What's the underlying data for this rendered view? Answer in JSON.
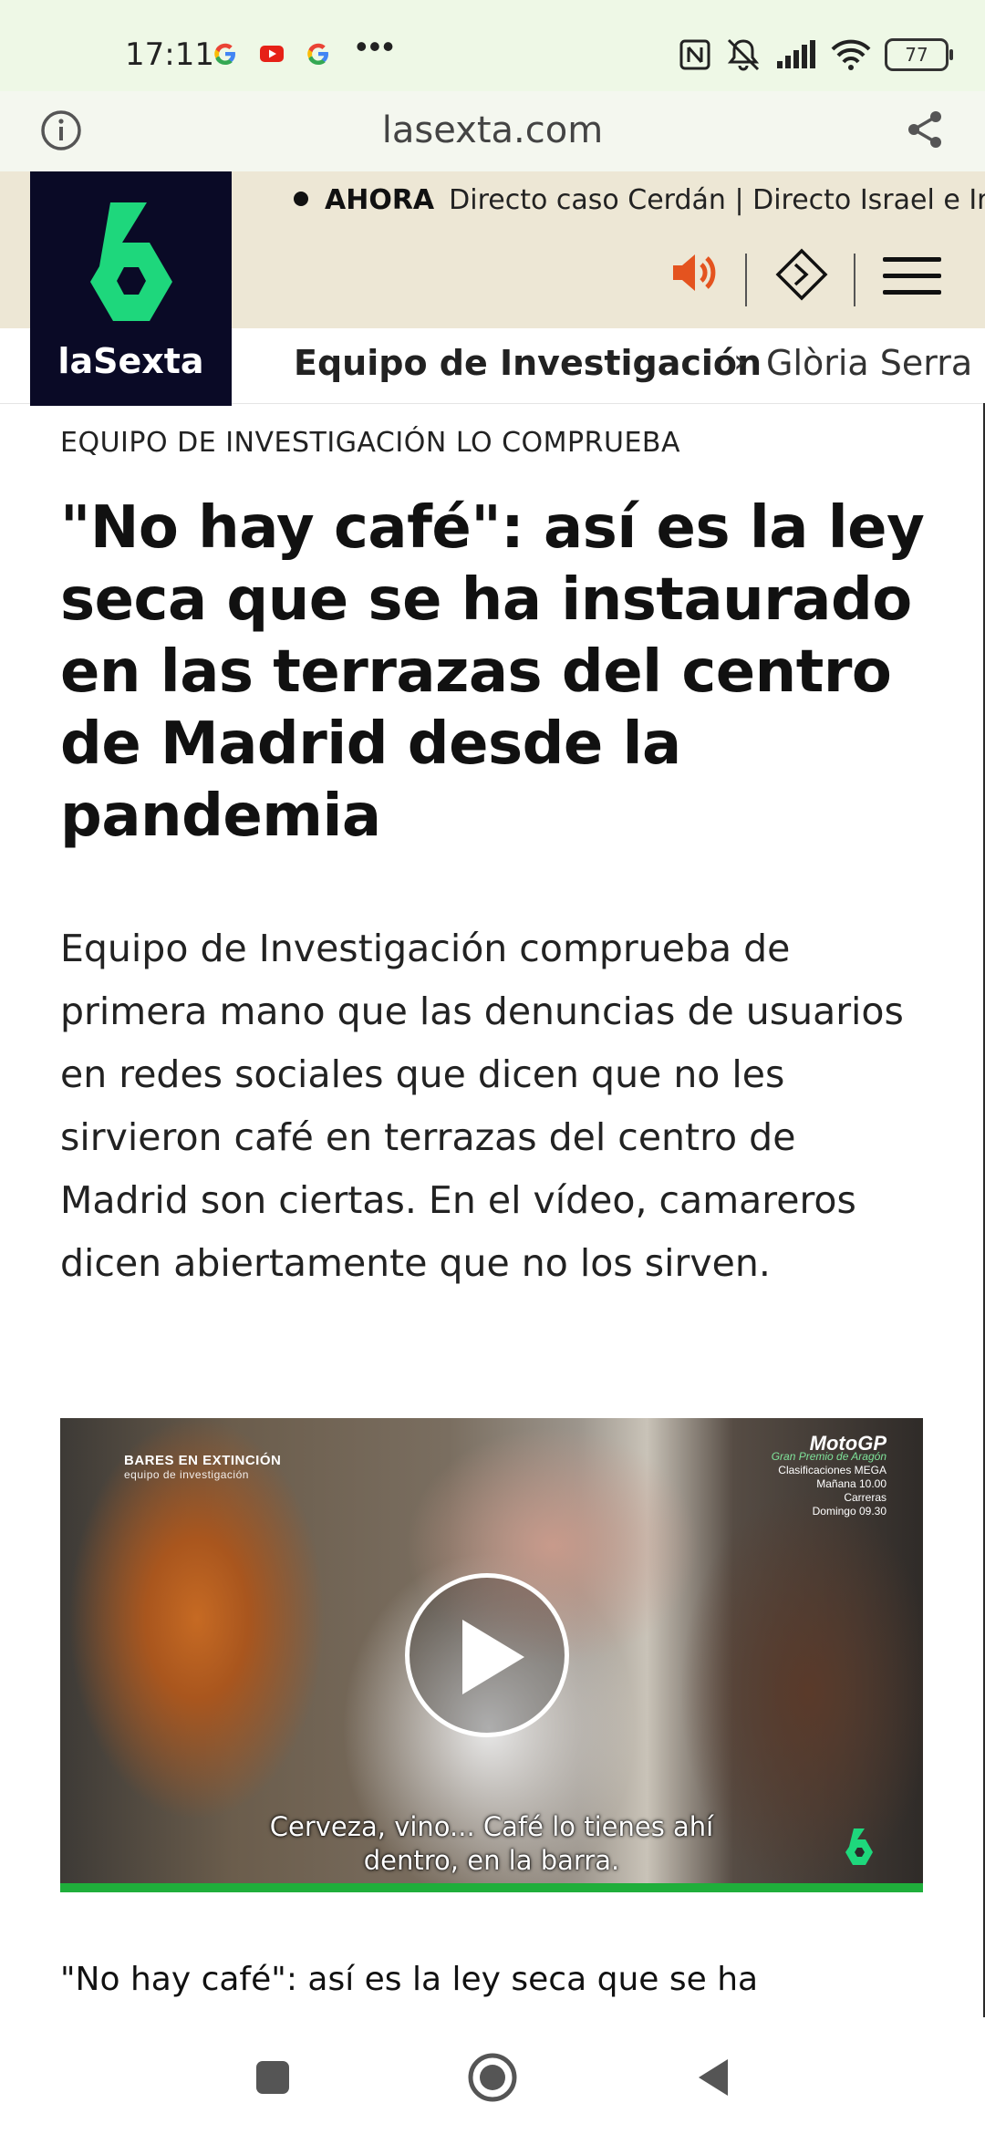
{
  "status_bar": {
    "time": "17:11",
    "notification_icons": [
      "google-icon",
      "youtube-icon",
      "google-icon"
    ],
    "more": "•••",
    "battery": "77",
    "system_icons": [
      "nfc-icon",
      "mute-icon",
      "signal-icon",
      "wifi-icon",
      "battery-icon"
    ]
  },
  "browser": {
    "url": "lasexta.com"
  },
  "site": {
    "logo_text": "laSexta",
    "ticker_label": "AHORA",
    "ticker_text": "Directo caso Cerdán | Directo Israel e Irán",
    "section": "Equipo de Investigación",
    "subsection_chevron": "›",
    "subsection": "Glòria Serra"
  },
  "article": {
    "kicker": "EQUIPO DE INVESTIGACIÓN LO COMPRUEBA",
    "headline": "\"No hay café\": así es la ley seca que se ha instaurado en las terrazas del centro de Madrid desde la pandemia",
    "lead": "Equipo de Investigación comprueba de primera mano que las denuncias de usuarios en redes sociales que dicen que no les sirvieron café en terrazas del centro de Madrid son ciertas. En el vídeo, camareros dicen abiertamente que no los sirven.",
    "video": {
      "overlay_title": "BARES EN EXTINCIÓN",
      "overlay_subtitle": "equipo de investigación",
      "promo_brand": "MotoGP",
      "promo_event": "Gran Premio de Aragón",
      "promo_line1": "Clasificaciones MEGA",
      "promo_line2": "Mañana 10.00",
      "promo_line3": "Carreras",
      "promo_line4": "Domingo 09.30",
      "subtitle_line1": "Cerveza, vino... Café lo tienes ahí",
      "subtitle_line2": "dentro, en la barra."
    },
    "video_caption": "\"No hay café\": así es la ley seca que se ha"
  },
  "colors": {
    "status_bar_bg": "#eef8e6",
    "header_beige": "#ede7d5",
    "logo_bg": "#0a0a26",
    "logo_green": "#1ed77c",
    "sound_orange": "#e4531f",
    "video_progress_green": "#1fae3b"
  }
}
